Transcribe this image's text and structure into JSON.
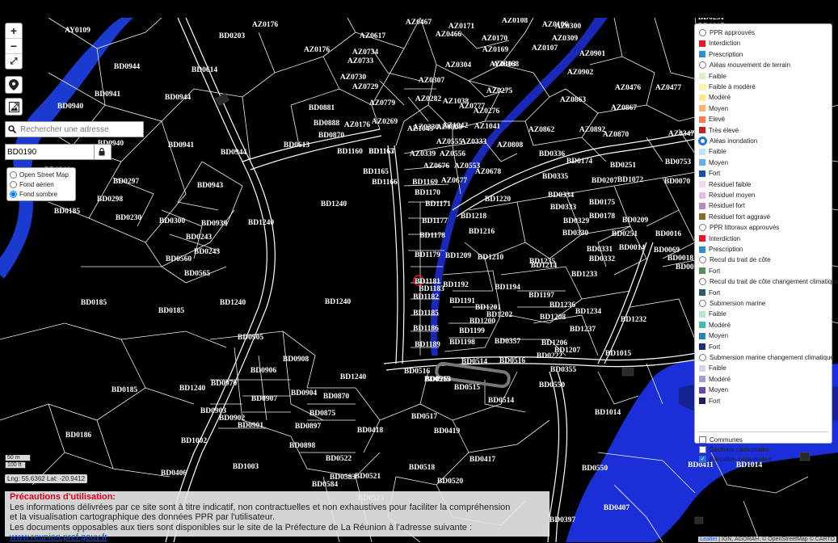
{
  "zoom": {
    "in": "+",
    "out": "−",
    "fullscreen": "⤢"
  },
  "search": {
    "placeholder": "Rechercher une adresse"
  },
  "parcel_search": {
    "value": "BD0190"
  },
  "basemaps": [
    {
      "label": "Open Street Map",
      "selected": false
    },
    {
      "label": "Fond aérien",
      "selected": false
    },
    {
      "label": "Fond sombre",
      "selected": true
    }
  ],
  "legend": {
    "items": [
      {
        "type": "radio",
        "label": "PPR approuvés",
        "selected": false
      },
      {
        "type": "swatch",
        "label": "Interdiction",
        "color": "#e8152b"
      },
      {
        "type": "swatch",
        "label": "Prescription",
        "color": "#2c8fd4"
      },
      {
        "type": "radio",
        "label": "Aléas mouvement de terrain",
        "selected": false
      },
      {
        "type": "swatch",
        "label": "Faible",
        "color": "#d7f0c4"
      },
      {
        "type": "swatch",
        "label": "Faible à modéré",
        "color": "#fff3a8"
      },
      {
        "type": "swatch",
        "label": "Modéré",
        "color": "#fde98a"
      },
      {
        "type": "swatch",
        "label": "Moyen",
        "color": "#f7b56a"
      },
      {
        "type": "swatch",
        "label": "Elevé",
        "color": "#f37a5a"
      },
      {
        "type": "swatch",
        "label": "Très élevé",
        "color": "#c0241e"
      },
      {
        "type": "radio",
        "label": "Aléas inondation",
        "selected": true
      },
      {
        "type": "swatch",
        "label": "Faible",
        "color": "#bfe3f7"
      },
      {
        "type": "swatch",
        "label": "Moyen",
        "color": "#5fb2ea"
      },
      {
        "type": "swatch",
        "label": "Fort",
        "color": "#1a4ea8"
      },
      {
        "type": "swatch",
        "label": "Résiduel faible",
        "color": "#f3d6ef"
      },
      {
        "type": "swatch",
        "label": "Résiduel moyen",
        "color": "#e9b8e4"
      },
      {
        "type": "swatch",
        "label": "Résiduel fort",
        "color": "#b58ac9"
      },
      {
        "type": "swatch",
        "label": "Résiduel fort aggravé",
        "color": "#8a6a2a"
      },
      {
        "type": "radio",
        "label": "PPR littoraux approuvés",
        "selected": false
      },
      {
        "type": "swatch",
        "label": "Interdiction",
        "color": "#e8152b"
      },
      {
        "type": "swatch",
        "label": "Prescription",
        "color": "#2c8fd4"
      },
      {
        "type": "radio",
        "label": "Recul du trait de côte",
        "selected": false
      },
      {
        "type": "swatch",
        "label": "Fort",
        "color": "#5a8a5a"
      },
      {
        "type": "radio",
        "label": "Recul du trait de côte changement climatique",
        "selected": false
      },
      {
        "type": "swatch",
        "label": "Fort",
        "color": "#2a5a6a"
      },
      {
        "type": "radio",
        "label": "Submersion marine",
        "selected": false
      },
      {
        "type": "swatch",
        "label": "Faible",
        "color": "#b8e6c8"
      },
      {
        "type": "swatch",
        "label": "Modéré",
        "color": "#3fbcb0"
      },
      {
        "type": "swatch",
        "label": "Moyen",
        "color": "#2a84b8"
      },
      {
        "type": "swatch",
        "label": "Fort",
        "color": "#1a2f7a"
      },
      {
        "type": "radio",
        "label": "Submersion marine changement climatique",
        "selected": false
      },
      {
        "type": "swatch",
        "label": "Faible",
        "color": "#d8d4ee"
      },
      {
        "type": "swatch",
        "label": "Modéré",
        "color": "#a89ad8"
      },
      {
        "type": "swatch",
        "label": "Moyen",
        "color": "#6a4aa8"
      },
      {
        "type": "swatch",
        "label": "Fort",
        "color": "#2a1a5a"
      }
    ],
    "layers": [
      {
        "label": "Communes",
        "checked": false
      },
      {
        "label": "Sections cadastrales",
        "checked": false
      },
      {
        "label": "Parcelles cadastrales",
        "checked": true
      }
    ]
  },
  "scale": {
    "metric": "50 m",
    "imperial": "100 ft"
  },
  "coords": "Lng: 55.6362 Lat: -20.9412",
  "notice": {
    "title": "Précautions d'utilisation:",
    "line1": "Les informations délivrées par ce site sont à titre indicatif, non contractuelles et non exhaustives pour faciliter la compréhension",
    "line2": "et la visualisation cartographique des données PPR par l'utilisateur.",
    "line3": "Les documents opposables aux tiers sont disponibles sur le site de la Préfecture de La Réunion à l'adresse suivante :",
    "link": "www.reunion.pref.gouv.fr"
  },
  "attribution": {
    "leaflet": "Leaflet",
    "rest": "| IGN, AGORAH, © OpenStreetMap © CARTO"
  },
  "map_labels": [
    "AY0109",
    "BD0203",
    "AZ0176",
    "AZ0617",
    "AZ0734",
    "AZ0733",
    "AZ0730",
    "AZ0729",
    "AZ0176",
    "BD0944",
    "BD0614",
    "BD0941",
    "BD0944",
    "BD0940",
    "BD0881",
    "BD0888",
    "BD0870",
    "BD0613",
    "AZ0176",
    "BD0940",
    "BD0941",
    "BD0944",
    "BD1160",
    "BD1163",
    "BD1165",
    "BD1166",
    "BD1167",
    "BD0297",
    "BD0298",
    "BD0940",
    "BD0943",
    "BD0185",
    "BD0230",
    "BD0300",
    "BD0939",
    "BD1240",
    "BD0243",
    "BD0243",
    "BD0560",
    "BD0565",
    "BD1240",
    "BD0185",
    "BD0185",
    "BD1240",
    "BD1240",
    "BD0905",
    "BD0906",
    "BD0908",
    "BD0907",
    "BD0904",
    "BD0870",
    "BD0970",
    "BD0903",
    "BD0902",
    "BD0901",
    "BD0897",
    "BD0875",
    "BD0898",
    "BD1240",
    "BD1240",
    "BD0185",
    "BD0186",
    "BD1002",
    "BD1003",
    "BD0406",
    "BD0522",
    "BD0583",
    "BD0584",
    "BD0523",
    "BD0521",
    "BD0520",
    "BD0518",
    "BD0418",
    "BD0419",
    "BD0417",
    "BD0517",
    "BD0516",
    "BD0515",
    "BD0514",
    "BD0515",
    "BD0514",
    "BD0516",
    "BD0253",
    "BD0357",
    "BD0355",
    "BD0222",
    "BD0550",
    "BD0550",
    "BD0407",
    "BD0397",
    "BD0411",
    "BD1014",
    "BD1014",
    "BD1015",
    "BD1232",
    "BD1233",
    "BD1234",
    "BD1235",
    "BD1236",
    "BD1237",
    "BD1208",
    "BD1206",
    "BD1207",
    "BD1197",
    "BD1194",
    "BD1192",
    "BD1191",
    "BD1201",
    "BD1202",
    "BD1200",
    "BD1199",
    "BD1198",
    "BD1189",
    "BD1186",
    "BD1185",
    "BD1182",
    "BD1181",
    "BD1183",
    "BD1179",
    "BD1178",
    "BD1177",
    "BD1171",
    "BD1170",
    "BD1169",
    "BD1209",
    "BD1210",
    "BD1216",
    "BD1218",
    "BD1220",
    "BD1214",
    "BD0332",
    "BD0331",
    "BD0330",
    "BD0329",
    "BD0333",
    "BD0334",
    "BD0335",
    "BD0336",
    "BD0178",
    "BD0175",
    "BD0174",
    "BD0251",
    "BD0207",
    "BD0209",
    "BD0251",
    "BD0014",
    "BD0016",
    "BD0018",
    "BD0068",
    "BD0069",
    "BD0070",
    "BD0753",
    "BD1072",
    "BD0251",
    "BD0017",
    "AZ0300",
    "AZ0309",
    "AZ0901",
    "AZ0902",
    "AZ0476",
    "AZ0477",
    "AZ0867",
    "AZ0863",
    "AZ0870",
    "AZ0347",
    "AZ0892",
    "AZ0862",
    "AZ0808",
    "AZ0678",
    "AZ0677",
    "AZ0676",
    "AZ0553",
    "AZ0556",
    "AZ0555",
    "AZ0339",
    "AZ0330",
    "AZ0909",
    "AZ0333",
    "AZ1042",
    "AZ1043",
    "AZ1041",
    "AZ0276",
    "AZ0275",
    "AZ0304",
    "AZ0303",
    "AZ0307",
    "AZ0282",
    "AZ1038",
    "AZ0777",
    "AZ0779",
    "AZ0269",
    "AZ0467",
    "AZ0466",
    "AZ0171",
    "AZ0170",
    "AZ0169",
    "AZ0168",
    "AZ0108",
    "AZ0107",
    "AZ0106",
    "AZ0655",
    "AZ0613",
    "AZ0256"
  ]
}
